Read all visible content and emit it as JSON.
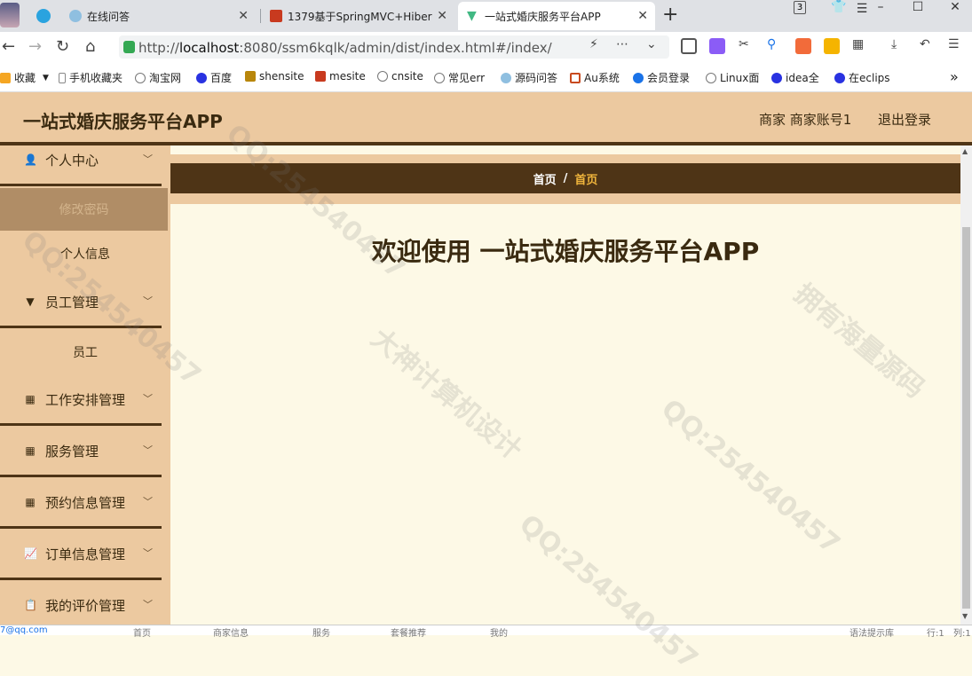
{
  "browser": {
    "tabs": [
      {
        "label": "在线问答"
      },
      {
        "label": "1379基于SpringMVC+Hiber"
      },
      {
        "label": "一站式婚庆服务平台APP"
      }
    ],
    "tab_count": "3",
    "url_prefix": "http://",
    "url_host": "localhost",
    "url_rest": ":8080/ssm6kqlk/admin/dist/index.html#/index/",
    "bookmarks": [
      "收藏",
      "手机收藏夹",
      "淘宝网",
      "百度",
      "shensite",
      "mesite",
      "cnsite",
      "常见err",
      "源码问答",
      "Au系统",
      "会员登录",
      "Linux面",
      "idea全",
      "在eclips"
    ]
  },
  "header": {
    "title": "一站式婚庆服务平台APP",
    "user": "商家 商家账号1",
    "logout": "退出登录"
  },
  "sidebar": {
    "personal_center": "个人中心",
    "change_password": "修改密码",
    "personal_info": "个人信息",
    "employee_mgmt": "员工管理",
    "employee": "员工",
    "work_mgmt": "工作安排管理",
    "service_mgmt": "服务管理",
    "booking_mgmt": "预约信息管理",
    "order_mgmt": "订单信息管理",
    "review_mgmt": "我的评价管理"
  },
  "breadcrumb": {
    "home": "首页",
    "separator": "/",
    "current": "首页"
  },
  "main": {
    "welcome": "欢迎使用 一站式婚庆服务平台APP"
  },
  "statusbar": {
    "email": "7@qq.com",
    "items": [
      "首页",
      "商家信息",
      "服务",
      "套餐推荐",
      "我的"
    ],
    "right1": "语法提示库",
    "right2": "行:1",
    "right3": "列:1"
  },
  "watermark": {
    "texts": [
      "QQ:254540457",
      "大神计算机设计",
      "拥有海量源码"
    ]
  },
  "colors": {
    "sidebar_bg": "#ecc9a0",
    "accent_dark": "#4e3416",
    "breadcrumb_current": "#f0b53c",
    "main_bg": "#fdf9e6"
  }
}
